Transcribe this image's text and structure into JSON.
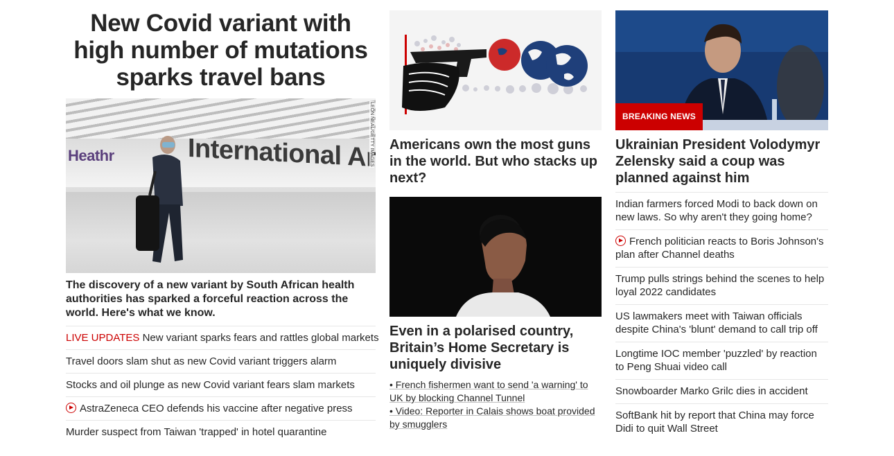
{
  "left": {
    "headline": "New Covid variant with high number of mutations sparks travel bans",
    "image": {
      "sign_left": "Heathr",
      "sign_main": "International Arrival",
      "credit": "LEON NEAL/GETTY IMAGES"
    },
    "dek": "The discovery of a new variant by South African health authorities has sparked a forceful reaction across the world. Here's what we know.",
    "links": [
      {
        "prefix": "LIVE UPDATES",
        "text": " New variant sparks fears and rattles global markets"
      },
      {
        "text": "Travel doors slam shut as new Covid variant triggers alarm"
      },
      {
        "text": "Stocks and oil plunge as new Covid variant fears slam markets"
      },
      {
        "text": "AstraZeneca CEO defends his vaccine after negative press",
        "icon": "play-icon"
      },
      {
        "text": "Murder suspect from Taiwan 'trapped' in hotel quarantine"
      }
    ]
  },
  "middle": {
    "story1": {
      "headline": "Americans own the most guns in the world. But who stacks up next?"
    },
    "story2": {
      "headline": "Even in a polarised country, Britain’s Home Secretary is uniquely divisive",
      "links": [
        "• French fishermen want to send 'a warning' to UK by blocking Channel Tunnel",
        "• Video: Reporter in Calais shows boat provided by smugglers"
      ]
    }
  },
  "right": {
    "badge": "BREAKING NEWS",
    "headline": "Ukrainian President Volodymyr Zelensky said a coup was planned against him",
    "links": [
      {
        "text": "Indian farmers forced Modi to back down on new laws. So why aren't they going home?"
      },
      {
        "text": "French politician reacts to Boris Johnson's plan after Channel deaths",
        "icon": "play-icon"
      },
      {
        "text": "Trump pulls strings behind the scenes to help loyal 2022 candidates"
      },
      {
        "text": "US lawmakers meet with Taiwan officials despite China's 'blunt' demand to call trip off"
      },
      {
        "text": "Longtime IOC member 'puzzled' by reaction to Peng Shuai video call"
      },
      {
        "text": "Snowboarder Marko Grilc dies in accident"
      },
      {
        "text": "SoftBank hit by report that China may force Didi to quit Wall Street"
      }
    ]
  },
  "colors": {
    "accent": "#cc0000",
    "text": "#262626",
    "divider": "#e6e6e6"
  }
}
